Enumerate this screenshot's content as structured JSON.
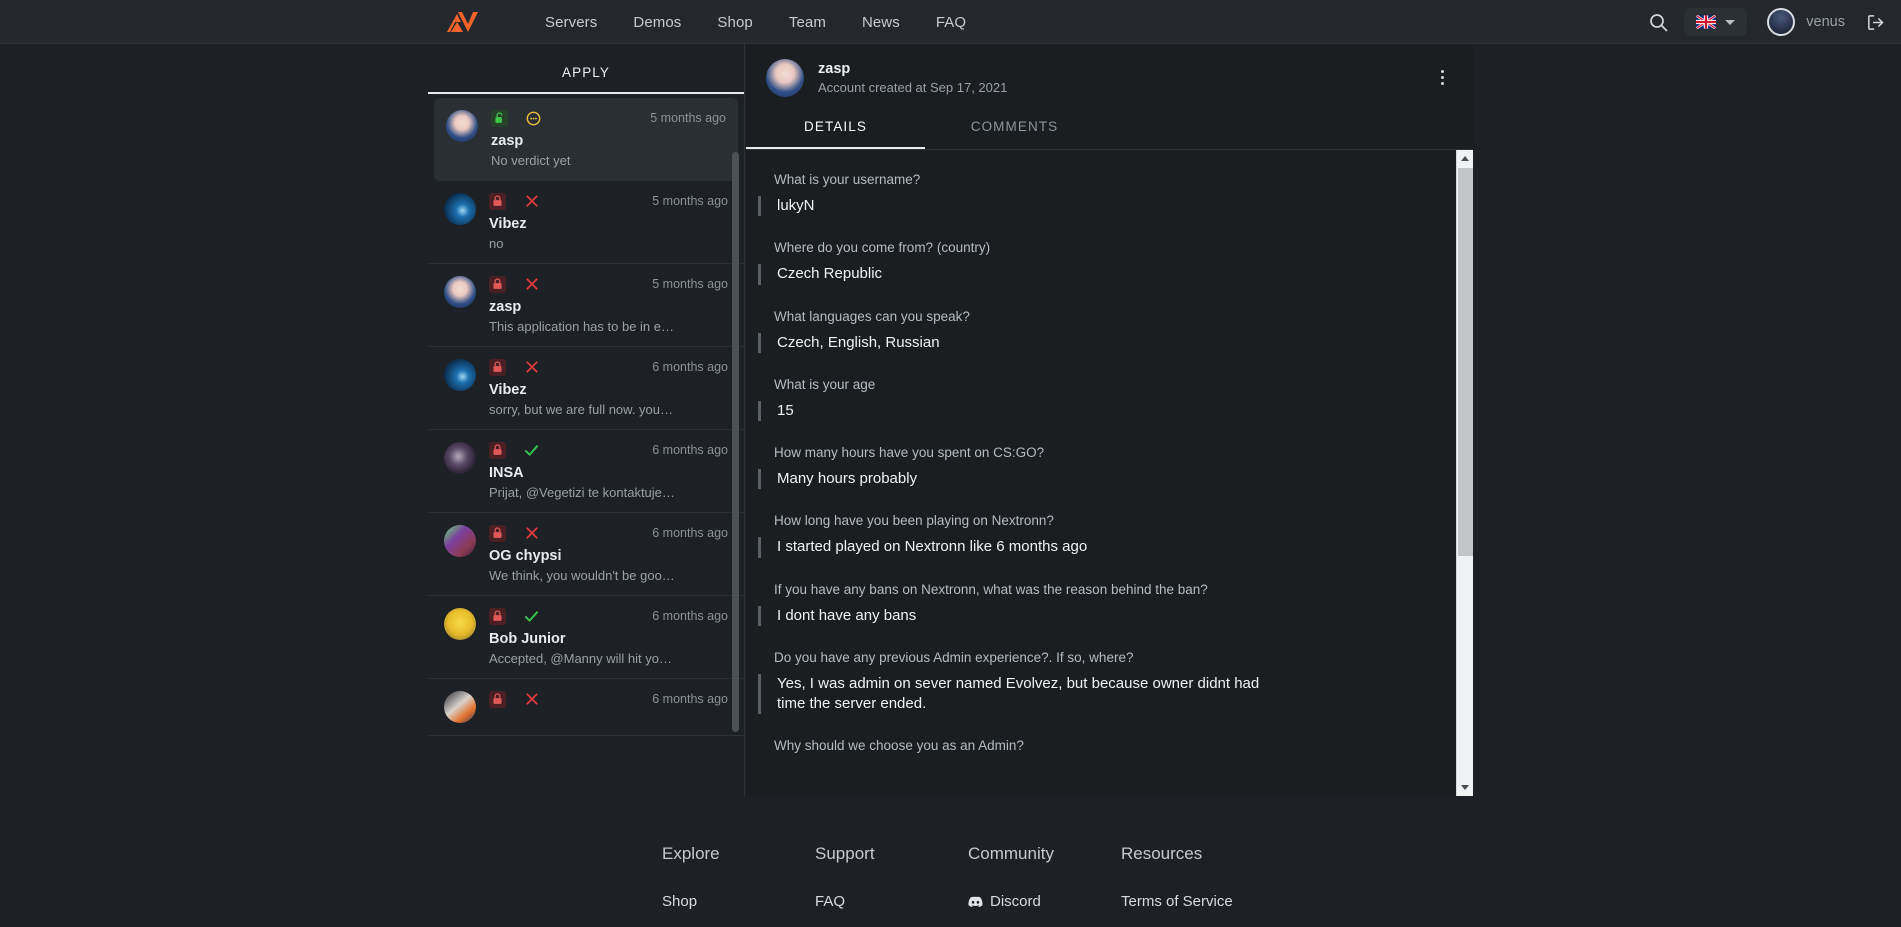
{
  "header": {
    "logo_name": "nextronn-logo",
    "nav": [
      {
        "label": "Servers"
      },
      {
        "label": "Demos"
      },
      {
        "label": "Shop"
      },
      {
        "label": "Team"
      },
      {
        "label": "News"
      },
      {
        "label": "FAQ"
      }
    ],
    "search_icon": "search-icon",
    "language": {
      "flag": "uk-flag",
      "chevron": "chevron-down-icon"
    },
    "user": {
      "name": "venus",
      "avatar": "user-avatar"
    },
    "logout_icon": "logout-icon"
  },
  "sidebar": {
    "tabs": [
      {
        "label": "APPLY",
        "active": true
      }
    ],
    "items": [
      {
        "name": "zasp",
        "time": "5 months ago",
        "desc": "No verdict yet",
        "lock": "unlocked",
        "verdict": "pending",
        "selected": true,
        "avatar": "anime-blue-hair"
      },
      {
        "name": "Vibez",
        "time": "5 months ago",
        "desc": "no",
        "lock": "locked",
        "verdict": "rejected",
        "selected": false,
        "avatar": "blue-orb"
      },
      {
        "name": "zasp",
        "time": "5 months ago",
        "desc": "This application has to be in e…",
        "lock": "locked",
        "verdict": "rejected",
        "selected": false,
        "avatar": "anime-blue-hair"
      },
      {
        "name": "Vibez",
        "time": "6 months ago",
        "desc": "sorry, but we are full now. you…",
        "lock": "locked",
        "verdict": "rejected",
        "selected": false,
        "avatar": "blue-orb"
      },
      {
        "name": "INSA",
        "time": "6 months ago",
        "desc": "Prijat, @Vegetizi te kontaktuje…",
        "lock": "locked",
        "verdict": "accepted",
        "selected": false,
        "avatar": "dark-portrait"
      },
      {
        "name": "OG chypsi",
        "time": "6 months ago",
        "desc": "We think, you wouldn't be goo…",
        "lock": "locked",
        "verdict": "rejected",
        "selected": false,
        "avatar": "purple-green-char"
      },
      {
        "name": "Bob Junior",
        "time": "6 months ago",
        "desc": "Accepted, @Manny will hit yo…",
        "lock": "locked",
        "verdict": "accepted",
        "selected": false,
        "avatar": "yellow-face"
      },
      {
        "name": "",
        "time": "6 months ago",
        "desc": "",
        "lock": "locked",
        "verdict": "rejected",
        "selected": false,
        "avatar": "anime-orange"
      }
    ]
  },
  "details": {
    "title": "zasp",
    "subtitle": "Account created at Sep 17, 2021",
    "avatar": "anime-blue-hair",
    "menu_icon": "kebab-menu-icon",
    "tabs": [
      {
        "label": "DETAILS",
        "active": true
      },
      {
        "label": "COMMENTS",
        "active": false
      }
    ],
    "qa": [
      {
        "q": "What is your username?",
        "a": "lukyN"
      },
      {
        "q": "Where do you come from? (country)",
        "a": "Czech Republic"
      },
      {
        "q": "What languages can you speak?",
        "a": "Czech, English, Russian"
      },
      {
        "q": "What is your age",
        "a": "15"
      },
      {
        "q": "How many hours have you spent on CS:GO?",
        "a": "Many hours probably"
      },
      {
        "q": "How long have you been playing on Nextronn?",
        "a": "I started played on Nextronn like 6 months ago"
      },
      {
        "q": "If you have any bans on Nextronn, what was the reason behind the ban?",
        "a": "I dont have any bans"
      },
      {
        "q": "Do you have any previous Admin experience?. If so, where?",
        "a": "Yes, I was admin on sever named Evolvez, but because owner didnt had time the server ended."
      },
      {
        "q": "Why should we choose you as an Admin?",
        "a": ""
      }
    ]
  },
  "footer": {
    "columns": [
      {
        "head": "Explore",
        "links": [
          {
            "label": "Shop",
            "icon": ""
          }
        ]
      },
      {
        "head": "Support",
        "links": [
          {
            "label": "FAQ",
            "icon": ""
          }
        ]
      },
      {
        "head": "Community",
        "links": [
          {
            "label": "Discord",
            "icon": "discord-icon"
          }
        ]
      },
      {
        "head": "Resources",
        "links": [
          {
            "label": "Terms of Service",
            "icon": ""
          }
        ]
      }
    ]
  },
  "colors": {
    "page_bg": "#1d2125",
    "panel_bg": "#1a1e21",
    "header_bg": "#24282c",
    "brand_orange": "#f4632a",
    "accent_green": "#3ec94a",
    "accent_red": "#e23b3b",
    "accent_yellow": "#e8c23a"
  }
}
